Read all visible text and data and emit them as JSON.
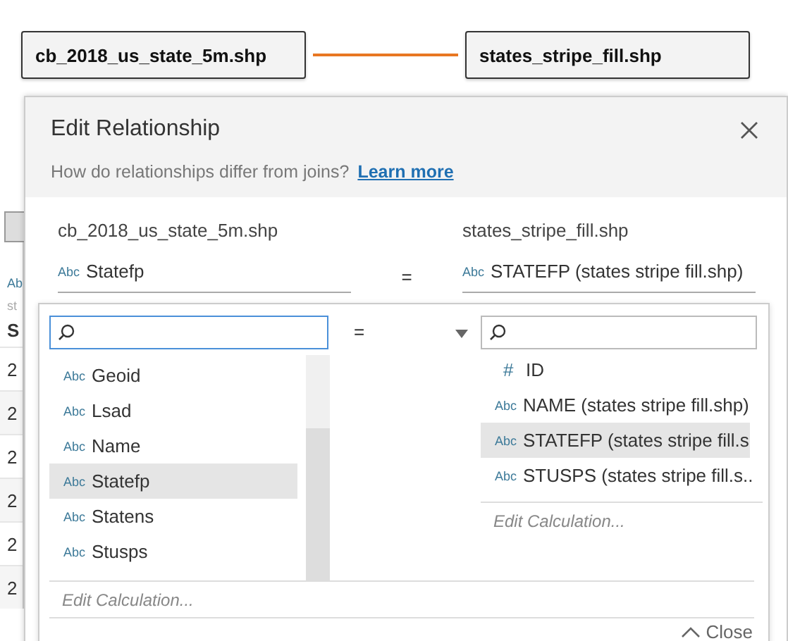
{
  "canvas": {
    "tables": [
      {
        "name": "cb_2018_us_state_5m.shp"
      },
      {
        "name": "states_stripe_fill.shp"
      }
    ]
  },
  "background_grid": {
    "type_label": "Ab",
    "source": "st",
    "column": "S",
    "cells": [
      "2",
      "2",
      "2",
      "2",
      "2",
      "2"
    ]
  },
  "dialog": {
    "title": "Edit Relationship",
    "hint": "How do relationships differ from joins?",
    "link": "Learn more",
    "left": {
      "table": "cb_2018_us_state_5m.shp",
      "field": {
        "type": "Abc",
        "name": "Statefp"
      }
    },
    "operator": "=",
    "right": {
      "table": "states_stripe_fill.shp",
      "field": {
        "type": "Abc",
        "name": "STATEFP (states stripe fill.shp)"
      }
    },
    "left_list": {
      "items": [
        {
          "type": "Abc",
          "name": "Geoid",
          "selected": false
        },
        {
          "type": "Abc",
          "name": "Lsad",
          "selected": false
        },
        {
          "type": "Abc",
          "name": "Name",
          "selected": false
        },
        {
          "type": "Abc",
          "name": "Statefp",
          "selected": true
        },
        {
          "type": "Abc",
          "name": "Statens",
          "selected": false
        },
        {
          "type": "Abc",
          "name": "Stusps",
          "selected": false
        }
      ],
      "footer": "Edit Calculation..."
    },
    "operator_select": "=",
    "right_list": {
      "items": [
        {
          "type": "#",
          "name": "ID",
          "selected": false
        },
        {
          "type": "Abc",
          "name": "NAME (states stripe fill.shp)",
          "selected": false
        },
        {
          "type": "Abc",
          "name": "STATEFP (states stripe fill.s",
          "selected": true
        },
        {
          "type": "Abc",
          "name": "STUSPS (states stripe fill.s..",
          "selected": false
        }
      ],
      "footer": "Edit Calculation..."
    },
    "close": "Close"
  }
}
